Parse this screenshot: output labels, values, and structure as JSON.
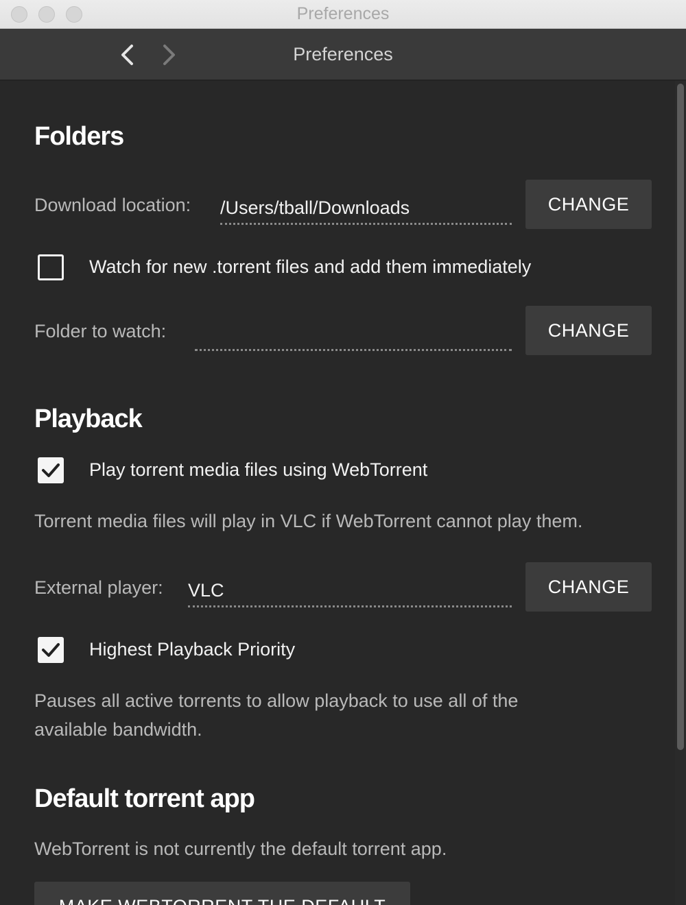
{
  "window": {
    "title": "Preferences"
  },
  "header": {
    "title": "Preferences"
  },
  "folders": {
    "title": "Folders",
    "download_label": "Download location:",
    "download_value": "/Users/tball/Downloads",
    "download_button": "CHANGE",
    "watch_checkbox_label": "Watch for new .torrent files and add them immediately",
    "watch_checked": false,
    "watch_folder_label": "Folder to watch:",
    "watch_folder_value": "",
    "watch_folder_button": "CHANGE"
  },
  "playback": {
    "title": "Playback",
    "play_in_webtorrent_label": "Play torrent media files using WebTorrent",
    "play_in_webtorrent_checked": true,
    "play_in_webtorrent_desc": "Torrent media files will play in VLC if WebTorrent cannot play them.",
    "external_player_label": "External player:",
    "external_player_value": "VLC",
    "external_player_button": "CHANGE",
    "priority_label": "Highest Playback Priority",
    "priority_checked": true,
    "priority_desc_line1": "Pauses all active torrents to allow playback to use all of the",
    "priority_desc_line2": "available bandwidth."
  },
  "default_app": {
    "title": "Default torrent app",
    "desc": "WebTorrent is not currently the default torrent app.",
    "button": "MAKE WEBTORRENT THE DEFAULT"
  },
  "icons": {
    "back": "chevron-left-icon",
    "forward": "chevron-right-icon",
    "check": "checkmark-icon"
  },
  "colors": {
    "background": "#282828",
    "header": "#3a3a3a",
    "button": "#3c3c3c",
    "text": "#f2f2f2",
    "muted_text": "#b9b9b9"
  }
}
